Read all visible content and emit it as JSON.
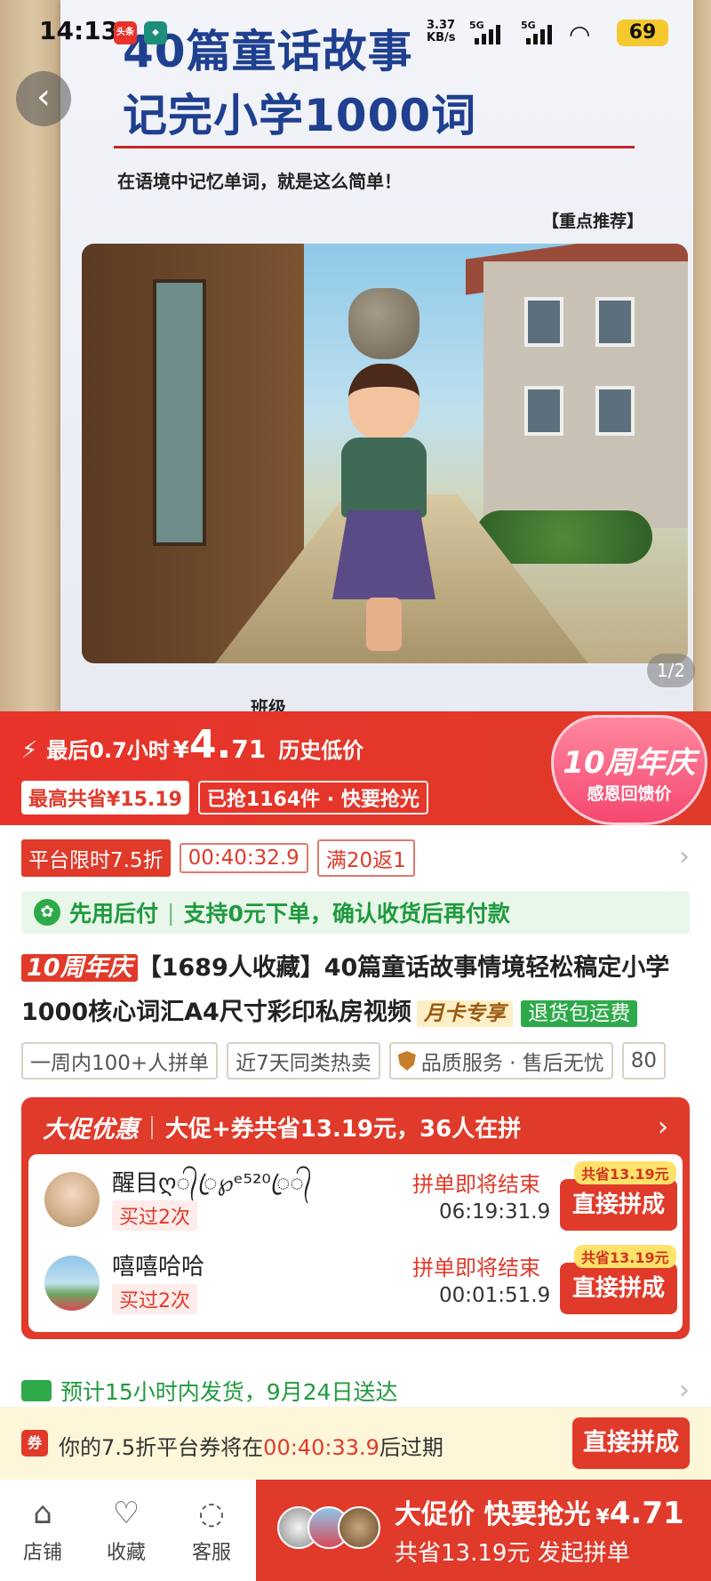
{
  "status_bar": {
    "time": "14:13",
    "net_speed_value": "3.37",
    "net_speed_unit": "KB/s",
    "sig1": "5G",
    "sig2": "5G",
    "battery": "69",
    "app_badge_1": "头条"
  },
  "gallery": {
    "book_title_line1": "40篇童话故事",
    "book_title_line2": "记完小学1000词",
    "book_subtitle": "在语境中记忆单词，就是这么简单！",
    "book_tag": "【重点推荐】",
    "book_footer": "班级",
    "page_indicator": "1/2"
  },
  "promo": {
    "countdown_text": "最后0.7小时",
    "currency": "¥",
    "price_int": "4.",
    "price_dec": "71",
    "price_value": 4.71,
    "low_label": "历史低价",
    "max_save": "最高共省¥15.19",
    "sold": "已抢1164件 · 快要抢光",
    "anniv_big": "10周年庆",
    "anniv_small": "感恩回馈价"
  },
  "limits": {
    "platform_discount": "平台限时7.5折",
    "timer": "00:40:32.9",
    "rebate": "满20返1"
  },
  "pay_later": {
    "label": "先用后付",
    "sep": "|",
    "text": "支持0元下单，确认收货后再付款"
  },
  "product": {
    "anniv_tag": "10周年庆",
    "title": "【1689人收藏】40篇童话故事情境轻松稿定小学1000核心词汇A4尺寸彩印私房视频",
    "month_card": "月卡专享",
    "return_tag": "退货包运费"
  },
  "features": [
    "一周内100+人拼单",
    "近7天同类热卖",
    "品质服务 · 售后无忧",
    "80"
  ],
  "group_buy": {
    "logo": "大促优惠",
    "desc": "大促+券共省13.19元，36人在拼",
    "rows": [
      {
        "user": "醒目ღ᭄ꦿ℘ᵉ⁵²⁰ꦿ᭄",
        "bought": "买过2次",
        "ending": "拼单即将结束",
        "countdown": "06:19:31.9",
        "button": "直接拼成",
        "save": "共省13.19元"
      },
      {
        "user": "嘻嘻哈哈",
        "bought": "买过2次",
        "ending": "拼单即将结束",
        "countdown": "00:01:51.9",
        "button": "直接拼成",
        "save": "共省13.19元"
      }
    ]
  },
  "shipping": {
    "text": "预计15小时内发货，9月24日送达"
  },
  "coupon": {
    "icon_text": "券",
    "text_before": "你的7.5折平台券将在",
    "timer": "00:40:33.9",
    "text_after": "后过期",
    "button": "直接拼成"
  },
  "bottom_nav": {
    "store": "店铺",
    "favorite": "收藏",
    "service": "客服",
    "buy_line1": "大促价 快要抢光",
    "buy_currency": "¥",
    "buy_price": "4.71",
    "buy_line2": "共省13.19元 发起拼单"
  },
  "colors": {
    "brand_red": "#e03a2a",
    "green": "#2eaa4a",
    "title_blue": "#1f3f8f"
  }
}
